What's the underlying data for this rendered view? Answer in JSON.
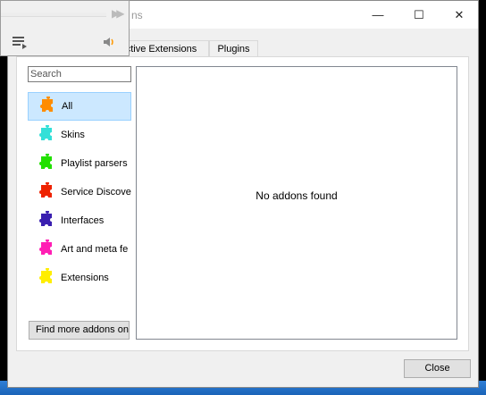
{
  "window": {
    "title_fragment": "ns",
    "controls": {
      "minimize": "—",
      "maximize": "☐",
      "close": "✕"
    }
  },
  "tabs": [
    {
      "label": "ctive Extensions"
    },
    {
      "label": "Plugins"
    }
  ],
  "search": {
    "placeholder": "Search"
  },
  "categories": [
    {
      "label": "All",
      "color": "#ff8c00",
      "selected": true
    },
    {
      "label": "Skins",
      "color": "#33e0d8"
    },
    {
      "label": "Playlist parsers",
      "color": "#22e000"
    },
    {
      "label": "Service Discove",
      "color": "#ee2200"
    },
    {
      "label": "Interfaces",
      "color": "#3a1fb0"
    },
    {
      "label": "Art and meta fe",
      "color": "#ff1fb4"
    },
    {
      "label": "Extensions",
      "color": "#ffee00"
    }
  ],
  "results": {
    "empty_message": "No addons found"
  },
  "buttons": {
    "find_more": "Find more addons onl",
    "close": "Close"
  },
  "player": {
    "fast_forward": "▶▶"
  }
}
